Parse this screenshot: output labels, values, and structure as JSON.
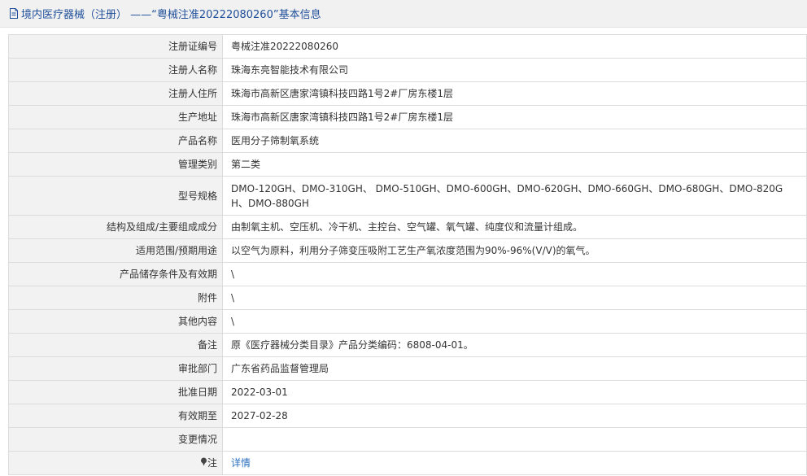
{
  "page_title": "境内医疗器械（注册）  ——“粤械注准20222080260”基本信息",
  "fields": [
    {
      "label": "注册证编号",
      "value": "粤械注准20222080260"
    },
    {
      "label": "注册人名称",
      "value": "珠海东亮智能技术有限公司"
    },
    {
      "label": "注册人住所",
      "value": "珠海市高新区唐家湾镇科技四路1号2#厂房东楼1层"
    },
    {
      "label": "生产地址",
      "value": "珠海市高新区唐家湾镇科技四路1号2#厂房东楼1层"
    },
    {
      "label": "产品名称",
      "value": "医用分子筛制氧系统"
    },
    {
      "label": "管理类别",
      "value": "第二类"
    },
    {
      "label": "型号规格",
      "value": "DMO-120GH、DMO-310GH、 DMO-510GH、DMO-600GH、DMO-620GH、DMO-660GH、DMO-680GH、DMO-820GH、DMO-880GH"
    },
    {
      "label": "结构及组成/主要组成成分",
      "value": "由制氧主机、空压机、冷干机、主控台、空气罐、氧气罐、纯度仪和流量计组成。"
    },
    {
      "label": "适用范围/预期用途",
      "value": "以空气为原料，利用分子筛变压吸附工艺生产氧浓度范围为90%-96%(V/V)的氧气。"
    },
    {
      "label": "产品储存条件及有效期",
      "value": "\\"
    },
    {
      "label": "附件",
      "value": "\\"
    },
    {
      "label": "其他内容",
      "value": "\\"
    },
    {
      "label": "备注",
      "value": "原《医疗器械分类目录》产品分类编码：6808-04-01。"
    },
    {
      "label": "审批部门",
      "value": "广东省药品监督管理局"
    },
    {
      "label": "批准日期",
      "value": "2022-03-01"
    },
    {
      "label": "有效期至",
      "value": "2027-02-28"
    },
    {
      "label": "变更情况",
      "value": ""
    }
  ],
  "note": {
    "label": "注",
    "link_text": "详情"
  },
  "icons": {
    "title": "document-icon",
    "note": "pin-icon"
  },
  "colors": {
    "title": "#1f4f9a",
    "link": "#2a6fc1",
    "label_bg": "#f2f2f2",
    "border": "#dcdcdc"
  }
}
